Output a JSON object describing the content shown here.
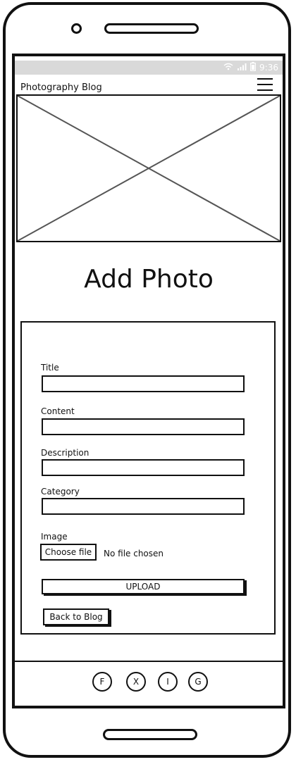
{
  "status_bar": {
    "time": "9:36",
    "wifi_icon": "wifi-icon",
    "signal_icon": "signal-icon",
    "battery_icon": "battery-icon"
  },
  "navbar": {
    "brand": "Photography Blog",
    "menu_icon": "hamburger-menu-icon"
  },
  "hero": {
    "placeholder": "image-placeholder"
  },
  "page": {
    "title": "Add Photo"
  },
  "form": {
    "fields": [
      {
        "label": "Title",
        "value": ""
      },
      {
        "label": "Content",
        "value": ""
      },
      {
        "label": "Description",
        "value": ""
      },
      {
        "label": "Category",
        "value": ""
      }
    ],
    "image_label": "Image",
    "choose_file_label": "Choose file",
    "no_file_text": "No file chosen",
    "upload_label": "UPLOAD",
    "back_label": "Back to Blog"
  },
  "footer": {
    "social": [
      {
        "letter": "F",
        "icon": "facebook-icon"
      },
      {
        "letter": "X",
        "icon": "x-icon"
      },
      {
        "letter": "I",
        "icon": "instagram-icon"
      },
      {
        "letter": "G",
        "icon": "github-icon"
      }
    ]
  }
}
